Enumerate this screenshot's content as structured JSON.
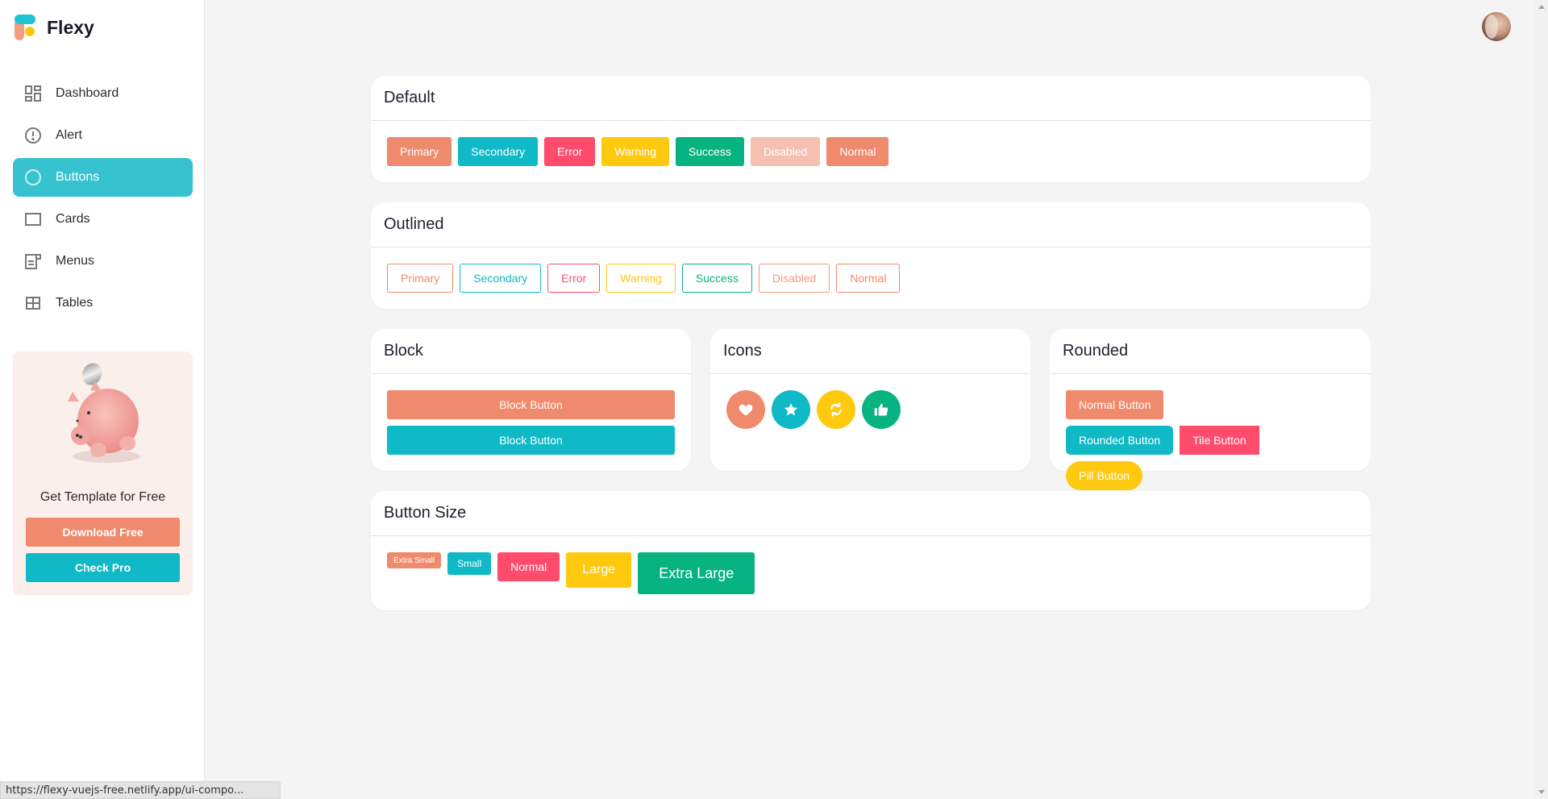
{
  "brand": {
    "name": "Flexy"
  },
  "sidebar": {
    "items": [
      {
        "label": "Dashboard",
        "icon": "dashboard-icon",
        "active": false
      },
      {
        "label": "Alert",
        "icon": "alert-circle-icon",
        "active": false
      },
      {
        "label": "Buttons",
        "icon": "circle-icon",
        "active": true
      },
      {
        "label": "Cards",
        "icon": "card-icon",
        "active": false
      },
      {
        "label": "Menus",
        "icon": "menu-icon",
        "active": false
      },
      {
        "label": "Tables",
        "icon": "table-icon",
        "active": false
      }
    ],
    "promo": {
      "text": "Get Template for Free",
      "download_label": "Download Free",
      "pro_label": "Check Pro"
    }
  },
  "colors": {
    "primary": "#ef8a6c",
    "secondary": "#10b9c6",
    "error": "#ff4c6d",
    "warning": "#fec90f",
    "success": "#08b382",
    "sidebar_active": "#36c3cf"
  },
  "sections": {
    "default": {
      "title": "Default",
      "buttons": [
        "Primary",
        "Secondary",
        "Error",
        "Warning",
        "Success",
        "Disabled",
        "Normal"
      ]
    },
    "outlined": {
      "title": "Outlined",
      "buttons": [
        "Primary",
        "Secondary",
        "Error",
        "Warning",
        "Success",
        "Disabled",
        "Normal"
      ]
    },
    "block": {
      "title": "Block",
      "buttons": [
        "Block Button",
        "Block Button"
      ]
    },
    "icons": {
      "title": "Icons",
      "buttons": [
        "heart-icon",
        "star-icon",
        "refresh-icon",
        "thumbs-up-icon"
      ]
    },
    "rounded": {
      "title": "Rounded",
      "buttons": [
        "Normal Button",
        "Rounded Button",
        "Tile Button",
        "Pill Button"
      ]
    },
    "size": {
      "title": "Button Size",
      "buttons": [
        "Extra Small",
        "Small",
        "Normal",
        "Large",
        "Extra Large"
      ]
    }
  },
  "status_bar": {
    "url": "https://flexy-vuejs-free.netlify.app/ui-compo..."
  }
}
